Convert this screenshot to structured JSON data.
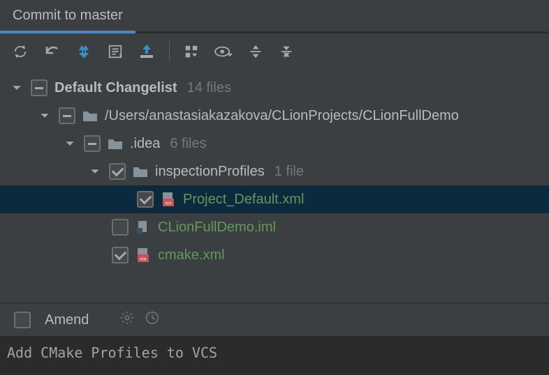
{
  "tab": {
    "title": "Commit to master"
  },
  "toolbar": {
    "icons": [
      "refresh",
      "revert",
      "diff",
      "changelist",
      "shelve",
      "group",
      "preview",
      "expand",
      "collapse"
    ]
  },
  "tree": {
    "changelist": {
      "label": "Default Changelist",
      "count": "14 files"
    },
    "root": {
      "path": "/Users/anastasiakazakova/CLionProjects/CLionFullDemo"
    },
    "idea": {
      "label": ".idea",
      "count": "6 files"
    },
    "inspection": {
      "label": "inspectionProfiles",
      "count": "1 file"
    },
    "files": {
      "project_default": "Project_Default.xml",
      "iml": "CLionFullDemo.iml",
      "cmake": "cmake.xml"
    }
  },
  "footer": {
    "amend": "Amend"
  },
  "message": "Add CMake Profiles to VCS"
}
